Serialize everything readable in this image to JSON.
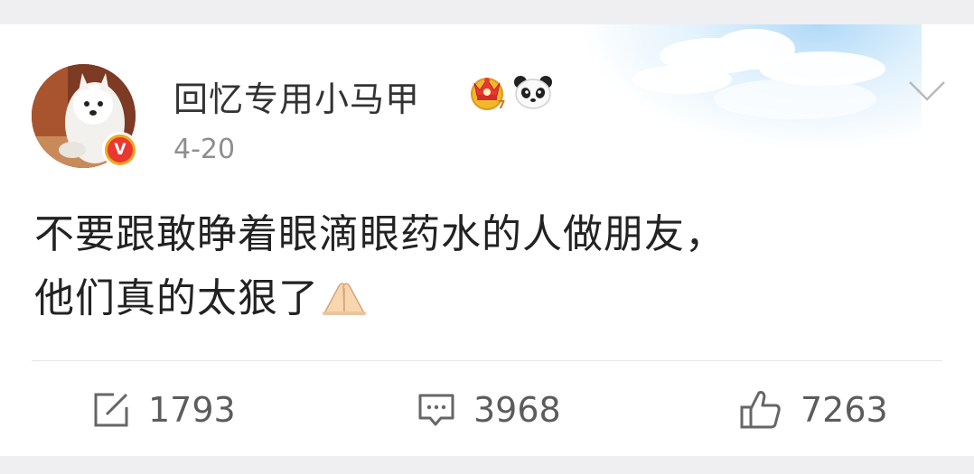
{
  "post": {
    "username": "回忆专用小马甲",
    "date": "4-20",
    "text_line1": "不要跟敢睁着眼滴眼药水的人做朋友，",
    "text_line2": "他们真的太狠了"
  },
  "badges": {
    "verified": "V",
    "crown_level": "7"
  },
  "actions": {
    "repost_count": "1793",
    "comment_count": "3968",
    "like_count": "7263"
  },
  "colors": {
    "verified_badge": "#e8382f",
    "crown": "#f2b82b",
    "text": "#222222",
    "meta": "#8f8f8f"
  }
}
